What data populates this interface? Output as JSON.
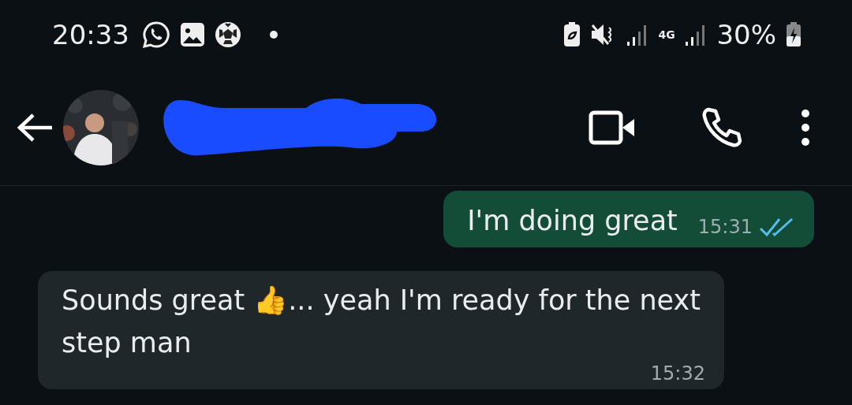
{
  "status_bar": {
    "time": "20:33",
    "network": "4G",
    "battery": "30%"
  },
  "messages": [
    {
      "kind": "outgoing",
      "text": "I'm doing great",
      "time": "15:31",
      "read": true
    },
    {
      "kind": "incoming",
      "text": "Sounds great 👍... yeah I'm ready for the next step man",
      "time": "15:32"
    }
  ]
}
